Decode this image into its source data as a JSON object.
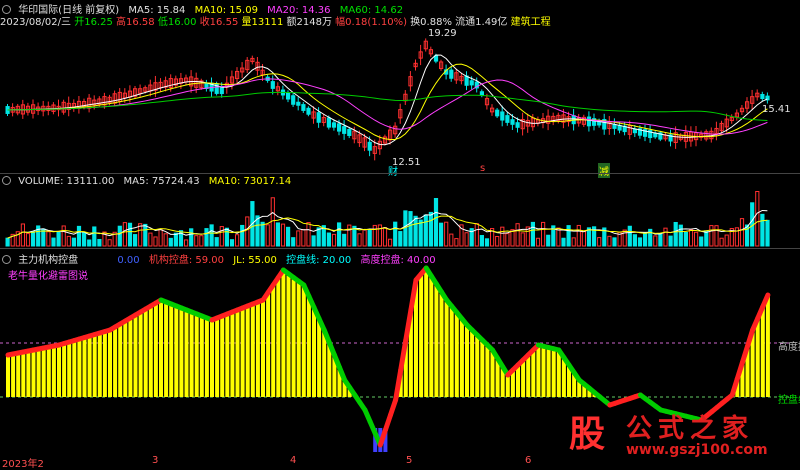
{
  "colors": {
    "up": "#ff3030",
    "down": "#00e5e5",
    "ma5": "#ffffff",
    "ma10": "#ffff00",
    "ma20": "#ff40ff",
    "ma60": "#00cc00",
    "bg": "#000000",
    "yellowBar": "#ffff00",
    "green": "#00cc00",
    "red": "#ff2020",
    "blue": "#4040ff"
  },
  "header": {
    "stock": "华印国际(日线 前复权)",
    "ma5_label": "MA5: 15.84",
    "ma10_label": "MA10: 15.09",
    "ma20_label": "MA20: 14.36",
    "ma60_label": "MA60: 14.62"
  },
  "info": {
    "date": "2023/08/02/三",
    "open": "开16.25",
    "high": "高16.58",
    "low": "低16.00",
    "close": "收16.55",
    "vol": "量13111",
    "amount": "额2148万",
    "range": "幅0.18(1.10%)",
    "turnover": "换0.88%",
    "float": "流通1.49亿",
    "sector": "建筑工程"
  },
  "price_panel": {
    "label_high": "19.29",
    "label_low": "12.51",
    "label_right": "15.41",
    "marker_cai": "财",
    "marker_s": "s",
    "marker_jian": "减"
  },
  "volume_panel": {
    "title": "VOLUME: 13111.00",
    "ma5": "MA5: 75724.43",
    "ma10": "MA10: 73017.14"
  },
  "indicator_panel": {
    "title": "主力机构控盘",
    "v1": "0.00",
    "v2": "机构控盘: 59.00",
    "v3": "JL: 55.00",
    "v4": "控盘线: 20.00",
    "v5": "高度控盘: 40.00",
    "subtitle": "老牛量化避雷图说",
    "line_label_high": "高度控",
    "line_label_low": "控盘线"
  },
  "xaxis": {
    "year": "2023年2",
    "m3": "3",
    "m4": "4",
    "m5": "5",
    "m6": "6"
  },
  "watermark": {
    "badge": "股",
    "title": "公式之家",
    "url": "www.gszj100.com"
  },
  "chart_data": [
    {
      "type": "candlestick",
      "title": "华印国际(日线 前复权)",
      "series": [
        {
          "name": "MA5",
          "values": [
            15.84
          ]
        },
        {
          "name": "MA10",
          "values": [
            15.09
          ]
        },
        {
          "name": "MA20",
          "values": [
            14.36
          ]
        },
        {
          "name": "MA60",
          "values": [
            14.62
          ]
        }
      ],
      "annotations": [
        "19.29",
        "12.51",
        "15.41"
      ]
    },
    {
      "type": "bar",
      "title": "VOLUME",
      "series": [
        {
          "name": "VOLUME",
          "values": [
            13111.0
          ]
        },
        {
          "name": "MA5",
          "values": [
            75724.43
          ]
        },
        {
          "name": "MA10",
          "values": [
            73017.14
          ]
        }
      ]
    },
    {
      "type": "bar",
      "title": "主力机构控盘",
      "series": [
        {
          "name": "机构控盘",
          "values": [
            59.0
          ]
        },
        {
          "name": "JL",
          "values": [
            55.0
          ]
        },
        {
          "name": "控盘线",
          "values": [
            20.0
          ]
        },
        {
          "name": "高度控盘",
          "values": [
            40.0
          ]
        }
      ]
    }
  ]
}
